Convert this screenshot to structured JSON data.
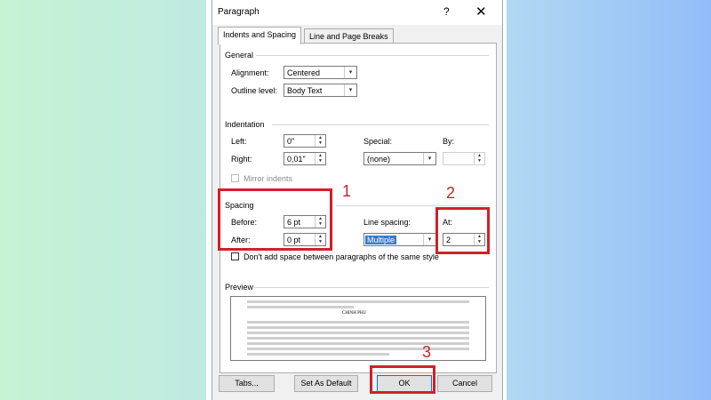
{
  "dialog": {
    "title": "Paragraph",
    "help_glyph": "?",
    "close_glyph": "✕"
  },
  "tabs": [
    {
      "label": "Indents and Spacing",
      "active": true
    },
    {
      "label": "Line and Page Breaks",
      "active": false
    }
  ],
  "general": {
    "heading": "General",
    "alignment_label": "Alignment:",
    "alignment_value": "Centered",
    "outline_label": "Outline level:",
    "outline_value": "Body Text"
  },
  "indentation": {
    "heading": "Indentation",
    "left_label": "Left:",
    "left_value": "0\"",
    "right_label": "Right:",
    "right_value": "0,01\"",
    "special_label": "Special:",
    "special_value": "(none)",
    "by_label": "By:",
    "by_value": "",
    "mirror_label": "Mirror indents"
  },
  "spacing": {
    "heading": "Spacing",
    "before_label": "Before:",
    "before_value": "6 pt",
    "after_label": "After:",
    "after_value": "0 pt",
    "line_spacing_label": "Line spacing:",
    "line_spacing_value": "Multiple",
    "at_label": "At:",
    "at_value": "2",
    "dont_add_label": "Don't add space between paragraphs of the same style"
  },
  "preview": {
    "heading": "Preview",
    "center_text": "CHINH PHU"
  },
  "buttons": {
    "tabs": "Tabs...",
    "set_default": "Set As Default",
    "ok": "OK",
    "cancel": "Cancel"
  },
  "annotations": {
    "one": "1",
    "two": "2",
    "three": "3"
  },
  "colors": {
    "annotation_red": "#d21f2a",
    "selection_blue": "#3379d4",
    "ok_border": "#0078d7"
  },
  "icons": {
    "dropdown": "▾",
    "spin_up": "▲",
    "spin_down": "▼"
  }
}
